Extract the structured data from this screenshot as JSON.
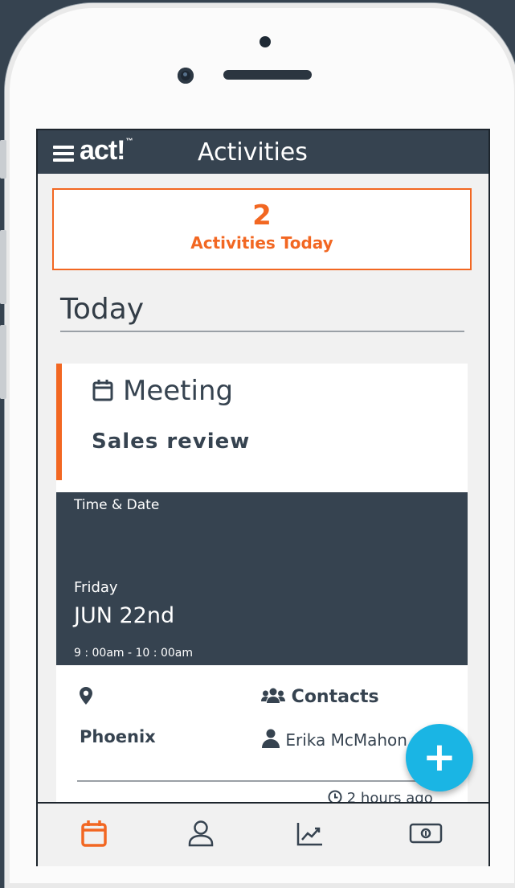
{
  "app": {
    "brand": "act!",
    "title": "Activities"
  },
  "summary": {
    "count": "2",
    "label": "Activities Today"
  },
  "section": {
    "heading": "Today"
  },
  "activity": {
    "type": "Meeting",
    "subject": "Sales review",
    "time_heading": "Time & Date",
    "weekday": "Friday",
    "date": "JUN 22nd",
    "time_range": "9 : 00am - 10 : 00am",
    "location": "Phoenix",
    "contacts_heading": "Contacts",
    "contact_name": "Erika McMahon",
    "updated": "2 hours ago"
  },
  "fab": {
    "label": "+"
  },
  "colors": {
    "accent": "#f26722",
    "header": "#364350",
    "fab": "#1ab5e4"
  },
  "bottom_nav": [
    {
      "icon": "calendar-icon",
      "active": true
    },
    {
      "icon": "contact-icon",
      "active": false
    },
    {
      "icon": "trend-chart-icon",
      "active": false
    },
    {
      "icon": "money-icon",
      "active": false
    }
  ]
}
